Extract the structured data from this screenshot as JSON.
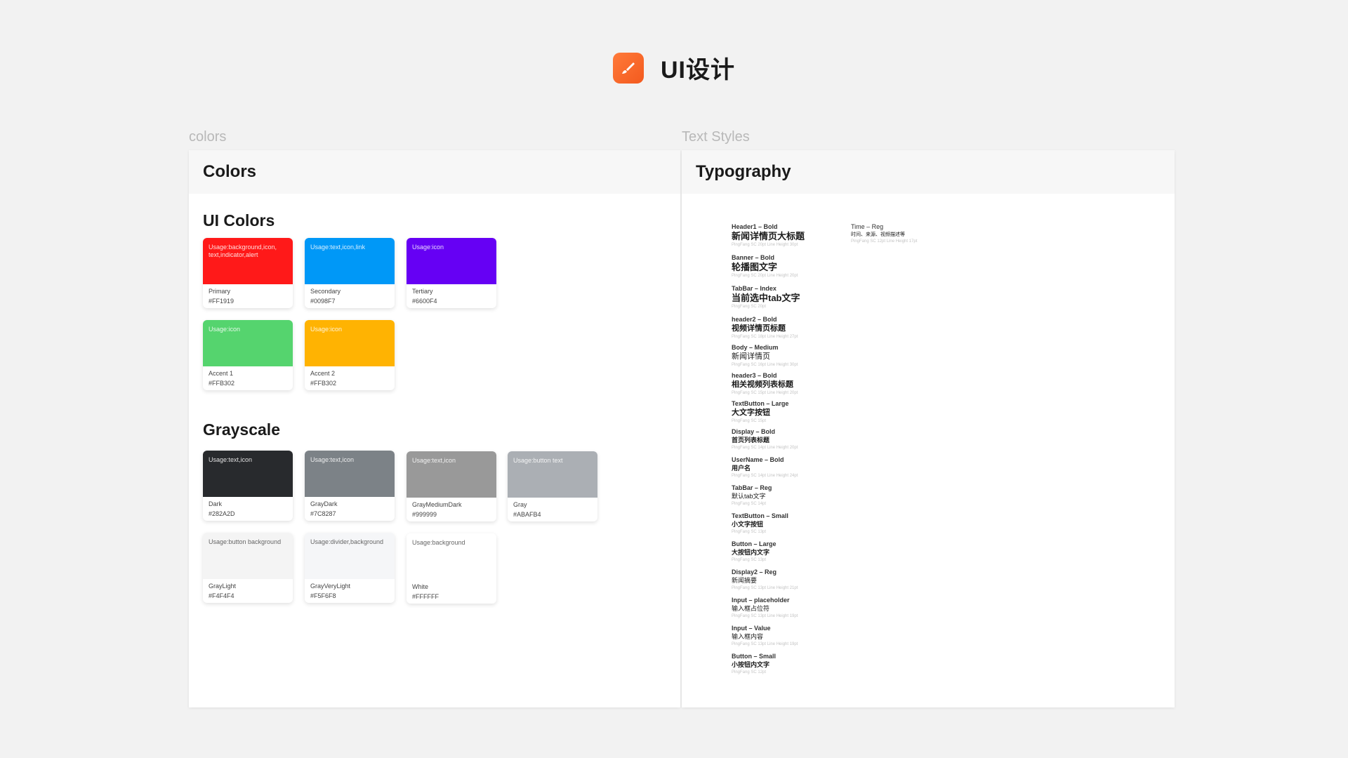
{
  "app": {
    "title": "UI设计",
    "logo_icon": "brush-icon",
    "logo_color": "#F5642A"
  },
  "captions": {
    "colors": "colors",
    "text_styles": "Text Styles"
  },
  "colors_board": {
    "title": "Colors",
    "ui_colors": {
      "title": "UI Colors",
      "swatches": [
        {
          "usage": "Usage:background,icon, text,indicator,alert",
          "name": "Primary",
          "hex": "#FF1919",
          "color": "#FF1919"
        },
        {
          "usage": "Usage:text,icon,link",
          "name": "Secondary",
          "hex": "#0098F7",
          "color": "#0098F7"
        },
        {
          "usage": "Usage:icon",
          "name": "Tertiary",
          "hex": "#6600F4",
          "color": "#6600F4"
        },
        {
          "usage": "Usage:icon",
          "name": "Accent 1",
          "hex": "#FFB302",
          "color": "#55D46E"
        },
        {
          "usage": "Usage:icon",
          "name": "Accent 2",
          "hex": "#FFB302",
          "color": "#FFB302"
        }
      ]
    },
    "grayscale": {
      "title": "Grayscale",
      "swatches": [
        {
          "usage": "Usage:text,icon",
          "name": "Dark",
          "hex": "#282A2D",
          "color": "#282A2D"
        },
        {
          "usage": "Usage:text,icon",
          "name": "GrayDark",
          "hex": "#7C8287",
          "color": "#7C8287"
        },
        {
          "usage": "Usage:text,icon",
          "name": "GrayMediumDark",
          "hex": "#999999",
          "color": "#999999"
        },
        {
          "usage": "Usage:button text",
          "name": "Gray",
          "hex": "#ABAFB4",
          "color": "#ABAFB4"
        },
        {
          "usage": "Usage:button background",
          "name": "GrayLight",
          "hex": "#F4F4F4",
          "color": "#F4F4F4"
        },
        {
          "usage": "Usage:divider,background",
          "name": "GrayVeryLight",
          "hex": "#F5F6F8",
          "color": "#F5F6F8"
        },
        {
          "usage": "Usage:background",
          "name": "White",
          "hex": "#FFFFFF",
          "color": "#FFFFFF"
        }
      ]
    }
  },
  "typography_board": {
    "title": "Typography",
    "styles": [
      {
        "label": "Header1 – Bold",
        "sample": "新闻详情页大标题",
        "spec": "PingFang SC 20pt Line Height 30pt"
      },
      {
        "label": "Banner – Bold",
        "sample": "轮播图文字",
        "spec": "PingFang SC 20pt Line Height 20pt"
      },
      {
        "label": "TabBar – Index",
        "sample": "当前选中tab文字",
        "spec": "PingFang SC 20pt"
      },
      {
        "label": "header2 – Bold",
        "sample": "视频详情页标题",
        "spec": "PingFang SC 18pt Line Height 27pt"
      },
      {
        "label": "Body – Medium",
        "sample": "新闻详情页",
        "spec": "PingFang SC 16pt Line Height 30pt"
      },
      {
        "label": "header3 – Bold",
        "sample": "相关视频列表标题",
        "spec": "PingFang SC 15pt Line Height 20pt"
      },
      {
        "label": "TextButton – Large",
        "sample": "大文字按钮",
        "spec": "PingFang SC 15pt"
      },
      {
        "label": "Display – Bold",
        "sample": "首页列表标题",
        "spec": "PingFang SC 14pt Line Height 20pt"
      },
      {
        "label": "UserName – Bold",
        "sample": "用户名",
        "spec": "PingFang SC 14pt Line Height 24pt"
      },
      {
        "label": "TabBar – Reg",
        "sample": "默认tab文字",
        "spec": "PingFang SC 14pt"
      },
      {
        "label": "TextButton – Small",
        "sample": "小文字按钮",
        "spec": "PingFang SC 13pt"
      },
      {
        "label": "Button – Large",
        "sample": "大按钮内文字",
        "spec": "PingFang SC 13pt"
      },
      {
        "label": "Display2 – Reg",
        "sample": "新闻摘要",
        "spec": "PingFang SC 13pt Line Height 21pt"
      },
      {
        "label": "Input – placeholder",
        "sample": "输入框占位符",
        "spec": "PingFang SC 13pt Line Height 19pt"
      },
      {
        "label": "Input – Value",
        "sample": "输入框内容",
        "spec": "PingFang SC 13pt Line Height 19pt"
      },
      {
        "label": "Button – Small",
        "sample": "小按钮内文字",
        "spec": "PingFang SC 12pt"
      }
    ],
    "side_style": {
      "label": "Time – Reg",
      "sample": "时间、来源、视频描述等",
      "spec": "PingFang SC 12pt Line Height 17pt"
    }
  }
}
